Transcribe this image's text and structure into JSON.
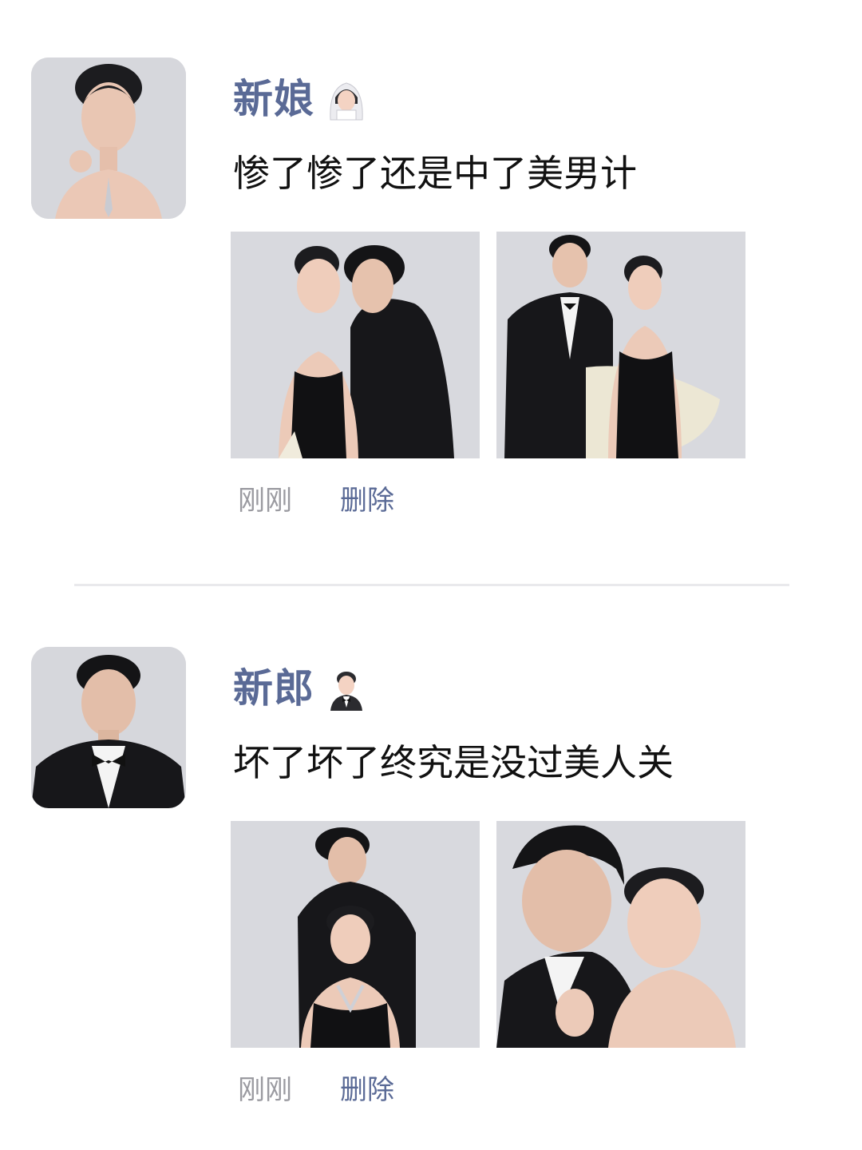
{
  "posts": [
    {
      "author": "新娘",
      "author_icon": "bride-emoji-icon",
      "caption": "惨了惨了还是中了美男计",
      "timestamp": "刚刚",
      "delete_label": "删除"
    },
    {
      "author": "新郎",
      "author_icon": "groom-emoji-icon",
      "caption": "坏了坏了终究是没过美人关",
      "timestamp": "刚刚",
      "delete_label": "删除"
    }
  ],
  "colors": {
    "name": "#5a6a96",
    "caption": "#111111",
    "timestamp": "#9a9aa0",
    "divider": "#e9e9ec",
    "photo_bg": "#dcdde2"
  }
}
